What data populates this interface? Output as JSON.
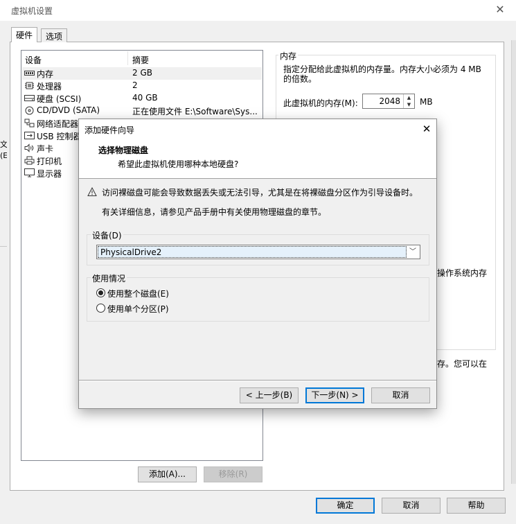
{
  "window": {
    "title": "虚拟机设置"
  },
  "tabs": [
    {
      "label": "硬件",
      "active": true
    },
    {
      "label": "选项",
      "active": false
    }
  ],
  "device_table": {
    "columns": [
      "设备",
      "摘要"
    ],
    "rows": [
      {
        "device": "内存",
        "summary": "2 GB",
        "icon": "memory-icon"
      },
      {
        "device": "处理器",
        "summary": "2",
        "icon": "cpu-icon"
      },
      {
        "device": "硬盘 (SCSI)",
        "summary": "40 GB",
        "icon": "harddisk-icon"
      },
      {
        "device": "CD/DVD (SATA)",
        "summary": "正在使用文件 E:\\Software\\Sys...",
        "icon": "cd-dvd-icon"
      },
      {
        "device": "网络适配器",
        "summary": "",
        "icon": "network-adapter-icon"
      },
      {
        "device": "USB 控制器",
        "summary": "",
        "icon": "usb-icon"
      },
      {
        "device": "声卡",
        "summary": "",
        "icon": "sound-icon"
      },
      {
        "device": "打印机",
        "summary": "",
        "icon": "printer-icon"
      },
      {
        "device": "显示器",
        "summary": "",
        "icon": "display-icon"
      }
    ],
    "add_button": "添加(A)...",
    "remove_button": "移除(R)"
  },
  "memory": {
    "group_label": "内存",
    "description": "指定分配给此虚拟机的内存量。内存大小必须为 4 MB 的倍数。",
    "field_label": "此虚拟机的内存(M):",
    "value": "2048",
    "unit": "MB"
  },
  "background_fragments": {
    "left_strip_1": "文",
    "left_strip_2": "(E",
    "os_memory": "操作系统内存",
    "swap_hint": "存。您可以在"
  },
  "footer": {
    "ok": "确定",
    "cancel": "取消",
    "help": "帮助"
  },
  "wizard": {
    "title": "添加硬件向导",
    "heading": "选择物理磁盘",
    "subheading": "希望此虚拟机使用哪种本地硬盘?",
    "warning": "访问裸磁盘可能会导致数据丢失或无法引导，尤其是在将裸磁盘分区作为引导设备时。",
    "info": "有关详细信息，请参见产品手册中有关使用物理磁盘的章节。",
    "device_label": "设备(D)",
    "device_value": "PhysicalDrive2",
    "usage_label": "使用情况",
    "usage_options": [
      {
        "label": "使用整个磁盘(E)",
        "selected": true
      },
      {
        "label": "使用单个分区(P)",
        "selected": false
      }
    ],
    "back_button": "< 上一步(B)",
    "next_button": "下一步(N) >",
    "cancel_button": "取消"
  }
}
